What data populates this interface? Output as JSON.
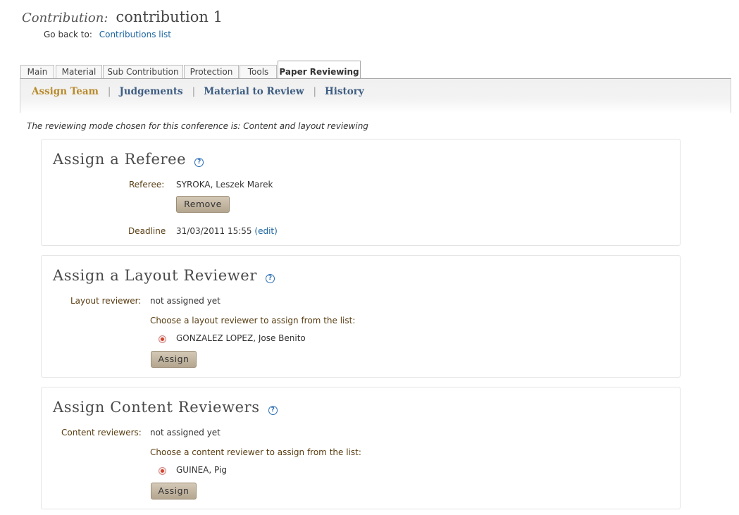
{
  "header": {
    "label": "Contribution:",
    "title": "contribution 1",
    "goback_label": "Go back to:",
    "goback_link": "Contributions list"
  },
  "tabs": [
    {
      "label": "Main"
    },
    {
      "label": "Material"
    },
    {
      "label": "Sub Contribution"
    },
    {
      "label": "Protection"
    },
    {
      "label": "Tools"
    },
    {
      "label": "Paper Reviewing",
      "active": true
    }
  ],
  "subtabs": [
    {
      "label": "Assign Team",
      "active": true
    },
    {
      "label": "Judgements"
    },
    {
      "label": "Material to Review"
    },
    {
      "label": "History"
    }
  ],
  "mode_text": "The reviewing mode chosen for this conference is: Content and layout reviewing",
  "referee": {
    "title": "Assign a Referee",
    "referee_label": "Referee:",
    "referee_value": "SYROKA, Leszek Marek",
    "remove_button": "Remove",
    "deadline_label": "Deadline",
    "deadline_value": "31/03/2011 15:55",
    "edit_link": "(edit)"
  },
  "layout": {
    "title": "Assign a Layout Reviewer",
    "reviewer_label": "Layout reviewer:",
    "reviewer_value": "not assigned yet",
    "choose_text": "Choose a layout reviewer to assign from the list:",
    "option": "GONZALEZ LOPEZ, Jose Benito",
    "assign_button": "Assign"
  },
  "content": {
    "title": "Assign Content Reviewers",
    "reviewer_label": "Content reviewers:",
    "reviewer_value": "not assigned yet",
    "choose_text": "Choose a content reviewer to assign from the list:",
    "option": "GUINEA, Pig",
    "assign_button": "Assign"
  },
  "icons": {
    "help": "help-question-icon",
    "radio": "radio-selected-icon"
  },
  "colors": {
    "link": "#1a64a0",
    "active_subtab": "#b88a2b",
    "subtab": "#3d5d82",
    "button": "#c4b8a3",
    "radio": "#d0432b"
  }
}
